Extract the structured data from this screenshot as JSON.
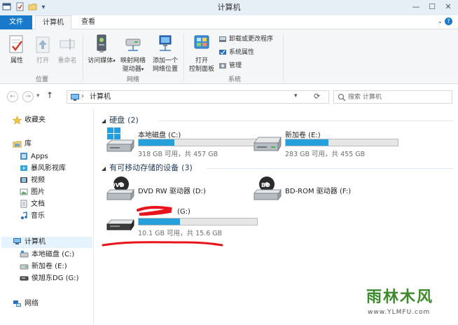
{
  "window": {
    "title": "计算机",
    "controls": {
      "minimize": "—",
      "maximize": "☐",
      "close": "✕"
    },
    "quick_access": {
      "properties_glyph": "▢",
      "newfolder_glyph": "▭",
      "dropdown_glyph": "▾"
    }
  },
  "ribbon": {
    "tabs": [
      {
        "label": "文件",
        "active": false
      },
      {
        "label": "计算机",
        "active": true
      },
      {
        "label": "查看",
        "active": false
      }
    ],
    "expand_glyph": "⌄",
    "help_glyph": "?",
    "groups": [
      {
        "label": "位置",
        "buttons": [
          {
            "label": "属性"
          },
          {
            "label": "打开"
          },
          {
            "label": "重命名"
          }
        ]
      },
      {
        "label": "网络",
        "buttons": [
          {
            "label": "访问媒体"
          },
          {
            "label": "映射网络驱动器"
          },
          {
            "label": "添加一个网络位置"
          }
        ]
      },
      {
        "label": "系统",
        "buttons": [
          {
            "label": "打开控制面板"
          }
        ],
        "small": [
          {
            "label": "卸载或更改程序"
          },
          {
            "label": "系统属性"
          },
          {
            "label": "管理"
          }
        ]
      }
    ],
    "labels": {
      "media_line1": "访问媒体",
      "map_line1": "映射网络",
      "map_line2": "驱动器",
      "add_line1": "添加一个",
      "add_line2": "网络位置",
      "cp_line1": "打开",
      "cp_line2": "控制面板"
    }
  },
  "address": {
    "path": "计算机",
    "search_placeholder": "搜索 计算机",
    "back_glyph": "←",
    "forward_glyph": "→",
    "up_glyph": "↑",
    "refresh_glyph": "⟳",
    "separator_glyph": "›",
    "dropdown_glyph": "▾"
  },
  "nav": {
    "favorites": "收藏夹",
    "libraries": "库",
    "library_items": [
      "Apps",
      "暴风影视库",
      "视频",
      "图片",
      "文档",
      "音乐"
    ],
    "computer": "计算机",
    "computer_items": [
      "本地磁盘 (C:)",
      "新加卷 (E:)",
      "侯旭东DG (G:)"
    ],
    "network": "网络"
  },
  "content": {
    "sections": [
      {
        "title": "硬盘",
        "count": "(2)"
      },
      {
        "title": "有可移动存储的设备",
        "count": "(3)"
      }
    ],
    "drives": [
      {
        "name": "本地磁盘 (C:)",
        "info": "318 GB 可用，共 457 GB",
        "used": 0.3
      },
      {
        "name": "新加卷 (E:)",
        "info": "283 GB 可用，共 455 GB",
        "used": 0.38
      },
      {
        "name": "DVD RW 驱动器 (D:)"
      },
      {
        "name": "BD-ROM 驱动器 (F:)"
      },
      {
        "name": "(G:)",
        "info": "10.1 GB 可用，共 15.6 GB",
        "used": 0.35
      }
    ]
  },
  "colors": {
    "accent": "#1979ca",
    "bar_fill": "#26a0da",
    "annotation": "#e8141c"
  },
  "watermark": {
    "text": "雨林木风",
    "url": "www.YLMFU.com"
  }
}
